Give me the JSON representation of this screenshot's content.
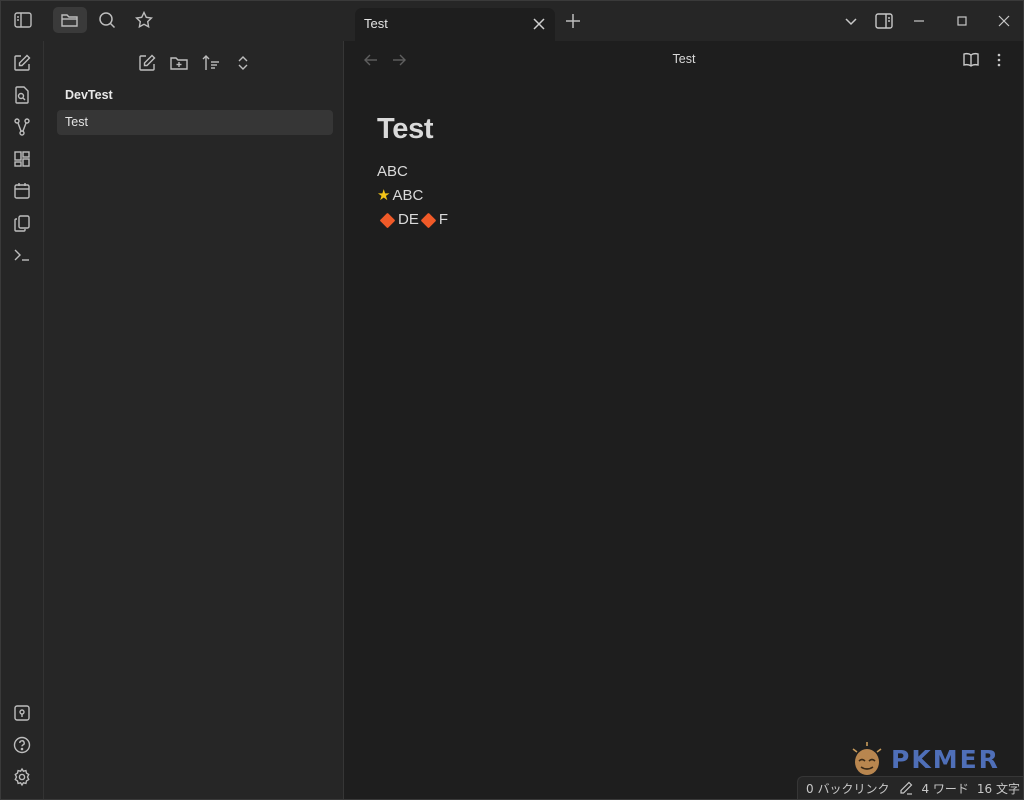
{
  "titlebar": {
    "tab_title": "Test"
  },
  "sidebar": {
    "vault_name": "DevTest",
    "files": [
      {
        "label": "Test"
      }
    ]
  },
  "main": {
    "view_title": "Test",
    "doc": {
      "heading": "Test",
      "lines": [
        {
          "text": "ABC"
        },
        {
          "prefix_icon": "star-emoji",
          "text": "ABC"
        },
        {
          "parts": [
            "DE",
            "F"
          ],
          "marker_icon": "orange-diamond-emoji"
        }
      ]
    }
  },
  "statusbar": {
    "backlinks": "0 バックリンク",
    "words": "4 ワード",
    "chars": "16 文字"
  },
  "watermark": {
    "text": "PKMER"
  },
  "colors": {
    "accent_blue": "#4f6fb8",
    "diamond": "#f05a28",
    "star": "#f5c518",
    "bg_main": "#1e1e1e",
    "bg_panel": "#262626"
  }
}
